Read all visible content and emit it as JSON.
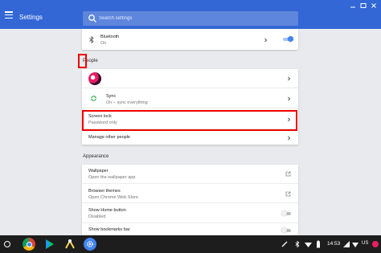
{
  "header": {
    "title": "Settings",
    "search_placeholder": "Search settings"
  },
  "colors": {
    "accent": "#3367d6",
    "highlight": "#e00000",
    "toggle_on": "#4285f4"
  },
  "bluetooth": {
    "label": "Bluetooth",
    "status": "On",
    "toggle_on": true
  },
  "people": {
    "heading": "People",
    "sync_label": "Sync",
    "sync_status": "On – sync everything",
    "screen_lock_label": "Screen lock",
    "screen_lock_value": "Password only",
    "manage_label": "Manage other people"
  },
  "appearance": {
    "heading": "Appearance",
    "wallpaper_label": "Wallpaper",
    "wallpaper_sub": "Open the wallpaper app",
    "themes_label": "Browser themes",
    "themes_sub": "Open Chrome Web Store",
    "home_label": "Show Home button",
    "home_sub": "Disabled",
    "home_toggle_on": false,
    "bookmarks_label": "Show bookmarks bar",
    "bookmarks_toggle_on": false
  },
  "shelf": {
    "apps": [
      "chrome-icon",
      "play-store-icon",
      "python-app-icon",
      "settings-app-icon"
    ],
    "time": "14:53",
    "locale": "US"
  }
}
